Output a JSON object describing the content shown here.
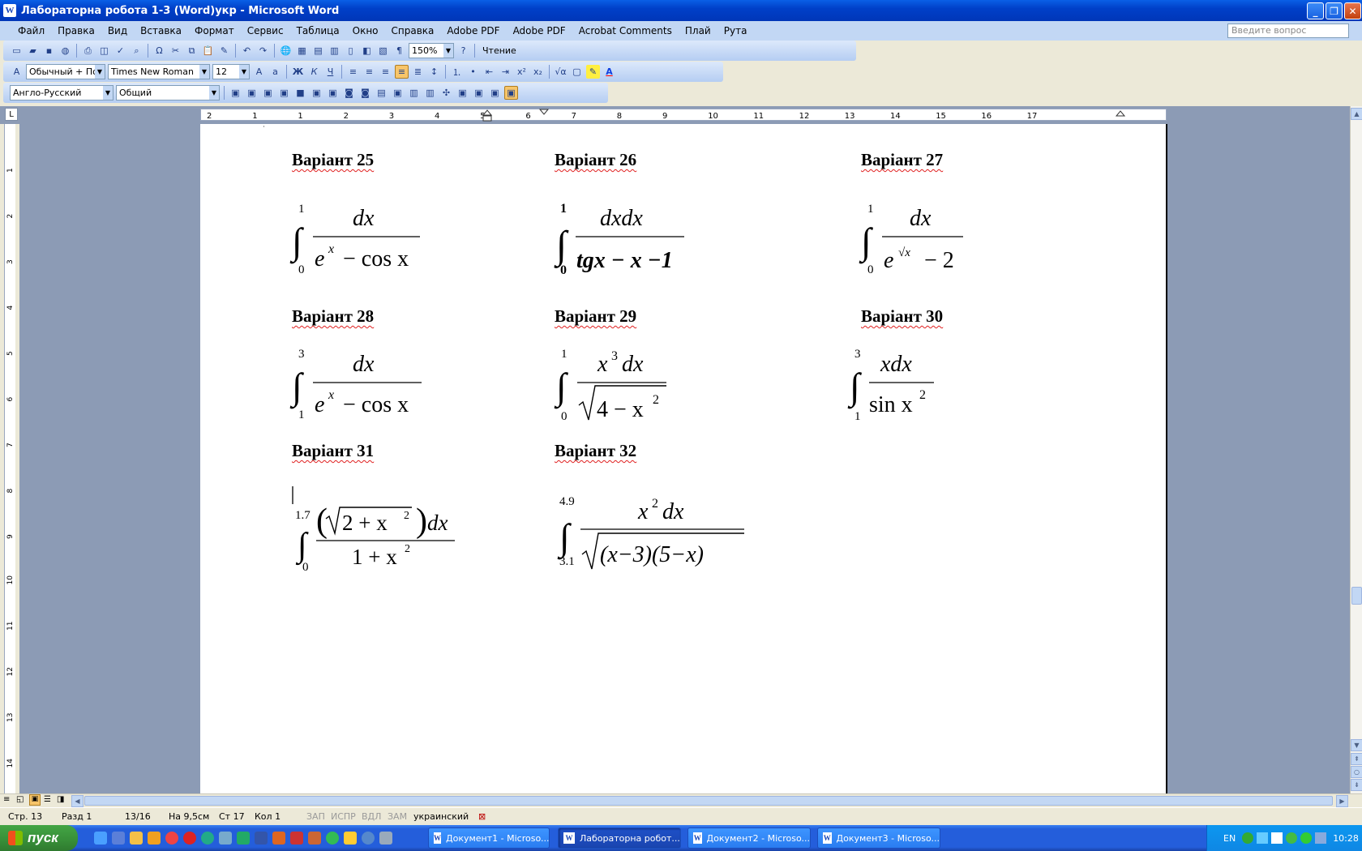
{
  "window": {
    "title": "Лабораторна робота 1-3 (Word)укр - Microsoft Word",
    "app_icon": "W"
  },
  "menu": {
    "items": [
      "Файл",
      "Правка",
      "Вид",
      "Вставка",
      "Формат",
      "Сервис",
      "Таблица",
      "Окно",
      "Справка",
      "Adobe PDF",
      "Adobe PDF",
      "Acrobat Comments",
      "Плай",
      "Рута"
    ],
    "ask_placeholder": "Введите вопрос"
  },
  "toolbar_standard": {
    "zoom": "150%",
    "reading_label": "Чтение"
  },
  "toolbar_formatting": {
    "style": "Обычный + По ц",
    "font": "Times New Roman",
    "size": "12"
  },
  "toolbar_translate": {
    "dictionary": "Англо-Русский",
    "subject": "Общий"
  },
  "ruler": {
    "numbers": [
      "2",
      "1",
      "1",
      "2",
      "3",
      "4",
      "5",
      "6",
      "7",
      "8",
      "9",
      "10",
      "11",
      "12",
      "13",
      "14",
      "15",
      "16",
      "17"
    ]
  },
  "vertical_ruler": {
    "numbers": [
      "1",
      "2",
      "3",
      "4",
      "5",
      "6",
      "7",
      "8",
      "9",
      "10",
      "11",
      "12",
      "13",
      "14"
    ]
  },
  "document": {
    "headers": {
      "v25": "Варіант 25",
      "v26": "Варіант 26",
      "v27": "Варіант 27",
      "v28": "Варіант 28",
      "v29": "Варіант 29",
      "v30": "Варіант 30",
      "v31": "Варіант 31",
      "v32": "Варіант 32"
    },
    "formulas": {
      "f25": {
        "upper": "1",
        "lower": "0",
        "num": "dx",
        "den_e": "e",
        "den_exp": "x",
        "den_rest": "− cos x"
      },
      "f26": {
        "upper": "1",
        "lower": "0",
        "num": "dxdx",
        "den": "tgx − x −1"
      },
      "f27": {
        "upper": "1",
        "lower": "0",
        "num": "dx",
        "den_e": "e",
        "den_exp": "√x",
        "den_rest": "− 2"
      },
      "f28": {
        "upper": "3",
        "lower": "1",
        "num": "dx",
        "den_e": "e",
        "den_exp": "x",
        "den_rest": "− cos x"
      },
      "f29": {
        "upper": "1",
        "lower": "0",
        "num_x": "x",
        "num_exp": "3",
        "num_rest": "dx",
        "den_in": "4 − x",
        "den_exp": "2"
      },
      "f30": {
        "upper": "3",
        "lower": "1",
        "num": "xdx",
        "den": "sin x",
        "den_exp": "2"
      },
      "f31": {
        "upper": "1.7",
        "lower": "0",
        "num_in": "2 +  x",
        "num_exp": "2",
        "num_dx": "dx",
        "den": "1 +  x",
        "den_exp": "2"
      },
      "f32": {
        "upper": "4.9",
        "lower": "3.1",
        "num_x": "x",
        "num_exp": "2",
        "num_rest": "dx",
        "den_in": "(x−3)(5−x)"
      }
    }
  },
  "statusbar": {
    "page": "Стр. 13",
    "section": "Разд 1",
    "pages": "13/16",
    "at": "На 9,5см",
    "line": "Ст 17",
    "col": "Кол 1",
    "rec": "ЗАП",
    "trk": "ИСПР",
    "ext": "ВДЛ",
    "ovr": "ЗАМ",
    "lang": "украинский"
  },
  "taskbar": {
    "start": "пуск",
    "buttons": [
      "Документ1 - Microso...",
      "Лабораторна робот...",
      "Документ2 - Microso...",
      "Документ3 - Microso..."
    ],
    "lang": "EN",
    "clock": "10:28"
  }
}
